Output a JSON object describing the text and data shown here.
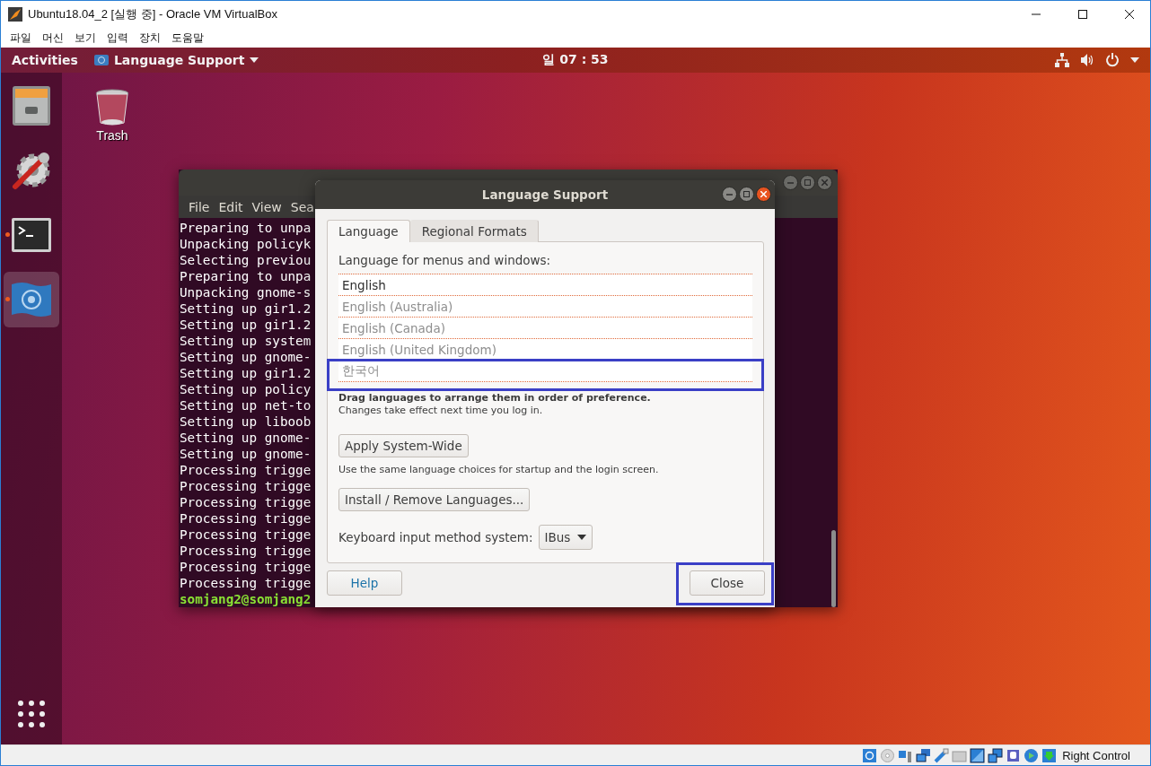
{
  "vbox_window": {
    "title": "Ubuntu18.04_2 [실행 중] - Oracle VM VirtualBox",
    "menu": [
      "파일",
      "머신",
      "보기",
      "입력",
      "장치",
      "도움말"
    ]
  },
  "top_bar": {
    "activities": "Activities",
    "app_menu": "Language Support",
    "clock": "일 07 : 53"
  },
  "dock": {
    "items": [
      {
        "kind": "files",
        "running": false,
        "selected": false
      },
      {
        "kind": "settings",
        "running": false,
        "selected": false
      },
      {
        "kind": "terminal",
        "running": true,
        "selected": false
      },
      {
        "kind": "language",
        "running": true,
        "selected": true
      }
    ]
  },
  "desktop_icons": [
    {
      "kind": "trash",
      "label": "Trash"
    }
  ],
  "terminal": {
    "menu": [
      "File",
      "Edit",
      "View",
      "Sea"
    ],
    "lines": [
      "Preparing to unpa",
      "Unpacking policyk",
      "Selecting previou",
      "Preparing to unpa",
      "Unpacking gnome-s",
      "Setting up gir1.2",
      "Setting up gir1.2",
      "Setting up system",
      "Setting up gnome-",
      "Setting up gir1.2",
      "Setting up policy",
      "Setting up net-to",
      "Setting up liboob",
      "Setting up gnome-",
      "Setting up gnome-",
      "Processing trigge",
      "Processing trigge",
      "Processing trigge",
      "Processing trigge",
      "Processing trigge",
      "Processing trigge",
      "Processing trigge",
      "Processing trigge"
    ],
    "prompt": "somjang2@somjang2"
  },
  "dialog": {
    "title": "Language Support",
    "tabs": [
      {
        "label": "Language",
        "selected": true
      },
      {
        "label": "Regional Formats",
        "selected": false
      }
    ],
    "list_label": "Language for menus and windows:",
    "languages": [
      {
        "name": "English",
        "dimmed": false,
        "highlighted": false
      },
      {
        "name": "English (Australia)",
        "dimmed": true,
        "highlighted": false
      },
      {
        "name": "English (Canada)",
        "dimmed": true,
        "highlighted": false
      },
      {
        "name": "English (United Kingdom)",
        "dimmed": true,
        "highlighted": false
      },
      {
        "name": "한국어",
        "dimmed": true,
        "highlighted": true
      }
    ],
    "hint_bold": "Drag languages to arrange them in order of preference.",
    "hint": "Changes take effect next time you log in.",
    "apply_button": "Apply System-Wide",
    "apply_note": "Use the same language choices for startup and the login screen.",
    "install_button": "Install / Remove Languages...",
    "keyboard_label": "Keyboard input method system:",
    "keyboard_value": "IBus",
    "help_button": "Help",
    "close_button": {
      "label": "Close",
      "highlighted": true
    }
  },
  "status_bar": {
    "host_key": "Right Control"
  }
}
